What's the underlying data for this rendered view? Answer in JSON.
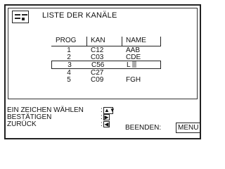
{
  "header": {
    "title": "LISTE DER KANÄLE",
    "icon": "channel-list-icon"
  },
  "table": {
    "columns": [
      "PROG",
      "KAN",
      "NAME"
    ],
    "rows": [
      {
        "prog": "1",
        "kan": "C12",
        "name": "AAB",
        "selected": false
      },
      {
        "prog": "2",
        "kan": "C03",
        "name": "CDE",
        "selected": false
      },
      {
        "prog": "3",
        "kan": "C56",
        "name": "L",
        "selected": true
      },
      {
        "prog": "4",
        "kan": "C27",
        "name": "",
        "selected": false
      },
      {
        "prog": "5",
        "kan": "C09",
        "name": "FGH",
        "selected": false
      }
    ]
  },
  "instructions": [
    {
      "label": "EIN ZEICHEN WÄHLEN",
      "key": "▲▼"
    },
    {
      "label": "BESTÄTIGEN",
      "key": "▶"
    },
    {
      "label": "ZURÜCK",
      "key": "◀"
    }
  ],
  "footer": {
    "exit_label": "BEENDEN:",
    "menu_label": "MENU"
  }
}
